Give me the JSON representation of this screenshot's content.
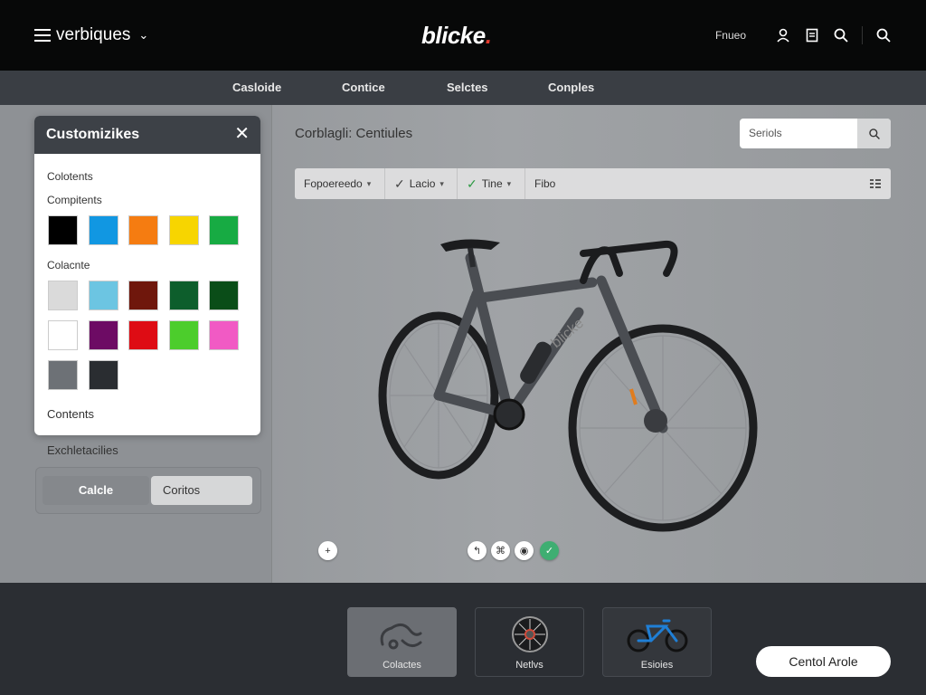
{
  "header": {
    "menu_label": "verbiques",
    "logo": "blicke",
    "logo_dot": ".",
    "tool_label": "Fnueo"
  },
  "nav": {
    "tabs": [
      "Casloide",
      "Contice",
      "Selctes",
      "Conples"
    ]
  },
  "customizer": {
    "title": "Customizikes",
    "section1": "Colotents",
    "section2": "Compitents",
    "row1": [
      "#000000",
      "#1197e2",
      "#f57c11",
      "#f7d500",
      "#17ab43"
    ],
    "section3": "Colacnte",
    "row2": [
      "#dadada",
      "#6cc5e2",
      "#6f170c",
      "#0d5e2c",
      "#0a4d18"
    ],
    "row3": [
      "#ffffff",
      "#6d0b64",
      "#de0c14",
      "#4ccd2c",
      "#f15ac4"
    ],
    "row4": [
      "#6d7176",
      "#2a2d31"
    ],
    "section4": "Contents",
    "below_label": "Exchletacilies",
    "segment": {
      "left": "Calcle",
      "right": "Coritos"
    }
  },
  "viewer": {
    "title": "Corblagli: Centiules",
    "search_placeholder": "Seriols",
    "filters": [
      {
        "label": "Fopoereedo",
        "caret": "▾"
      },
      {
        "label": "Lacio",
        "caret": "▾",
        "check": "✓"
      },
      {
        "label": "Tine",
        "caret": "▾",
        "check": "✓"
      },
      {
        "label": "Fibo"
      }
    ],
    "controls": [
      "+",
      "↰",
      "⌘",
      "◉",
      "✓"
    ]
  },
  "bottom": {
    "cards": [
      "Colactes",
      "Netlvs",
      "Esioies"
    ],
    "cta": "Centol Arole"
  },
  "colors": {
    "accent": "#e23a2c",
    "frame": "#4a4d52",
    "header": "#070808"
  }
}
